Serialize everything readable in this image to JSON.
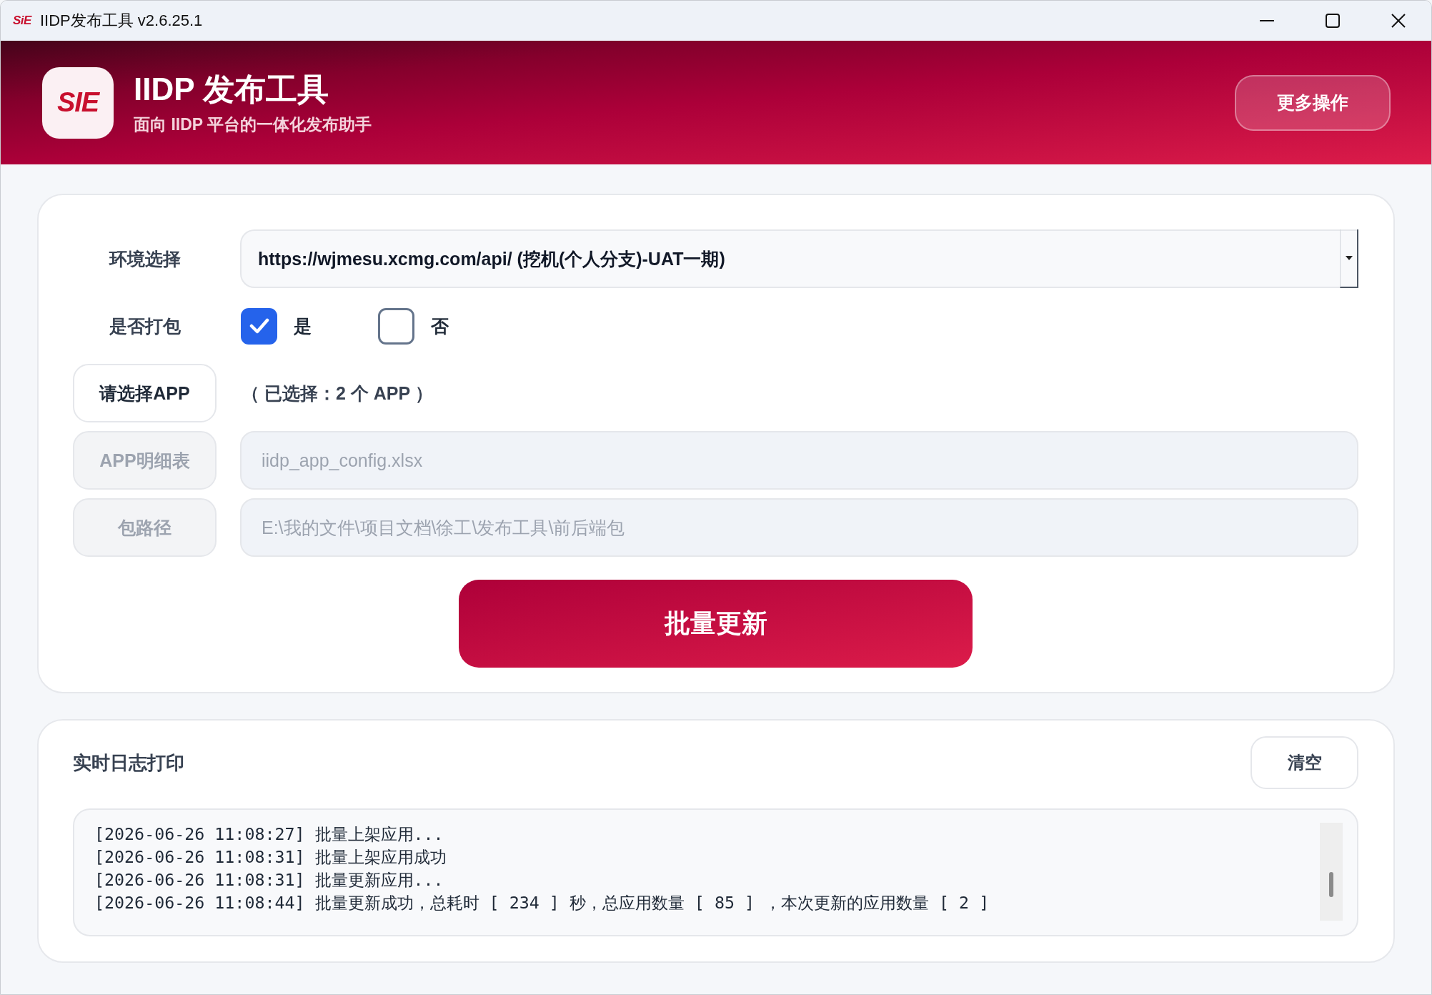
{
  "window": {
    "logo": "SiE",
    "title": "IIDP发布工具 v2.6.25.1"
  },
  "header": {
    "logo": "SIE",
    "title": "IIDP 发布工具",
    "subtitle": "面向 IIDP 平台的一体化发布助手",
    "more_button": "更多操作"
  },
  "form": {
    "environment": {
      "label": "环境选择",
      "value": "https://wjmesu.xcmg.com/api/ (挖机(个人分支)-UAT一期)"
    },
    "package": {
      "label": "是否打包",
      "options": [
        {
          "label": "是",
          "checked": true
        },
        {
          "label": "否",
          "checked": false
        }
      ]
    },
    "app_select": {
      "button": "请选择APP",
      "summary": "（ 已选择：2 个 APP ）"
    },
    "files": [
      {
        "button": "APP明细表",
        "value": "iidp_app_config.xlsx",
        "disabled": true
      },
      {
        "button": "包路径",
        "value": "E:\\我的文件\\项目文档\\徐工\\发布工具\\前后端包",
        "disabled": true
      }
    ],
    "submit_button": "批量更新"
  },
  "log": {
    "title": "实时日志打印",
    "clear_button": "清空",
    "lines": [
      "[2026-06-26 11:08:27] 批量上架应用...",
      "[2026-06-26 11:08:31] 批量上架应用成功",
      "[2026-06-26 11:08:31] 批量更新应用...",
      "[2026-06-26 11:08:44] 批量更新成功，总耗时 [ 234 ] 秒，总应用数量 [ 85 ] ，本次更新的应用数量 [ 2 ]"
    ]
  }
}
